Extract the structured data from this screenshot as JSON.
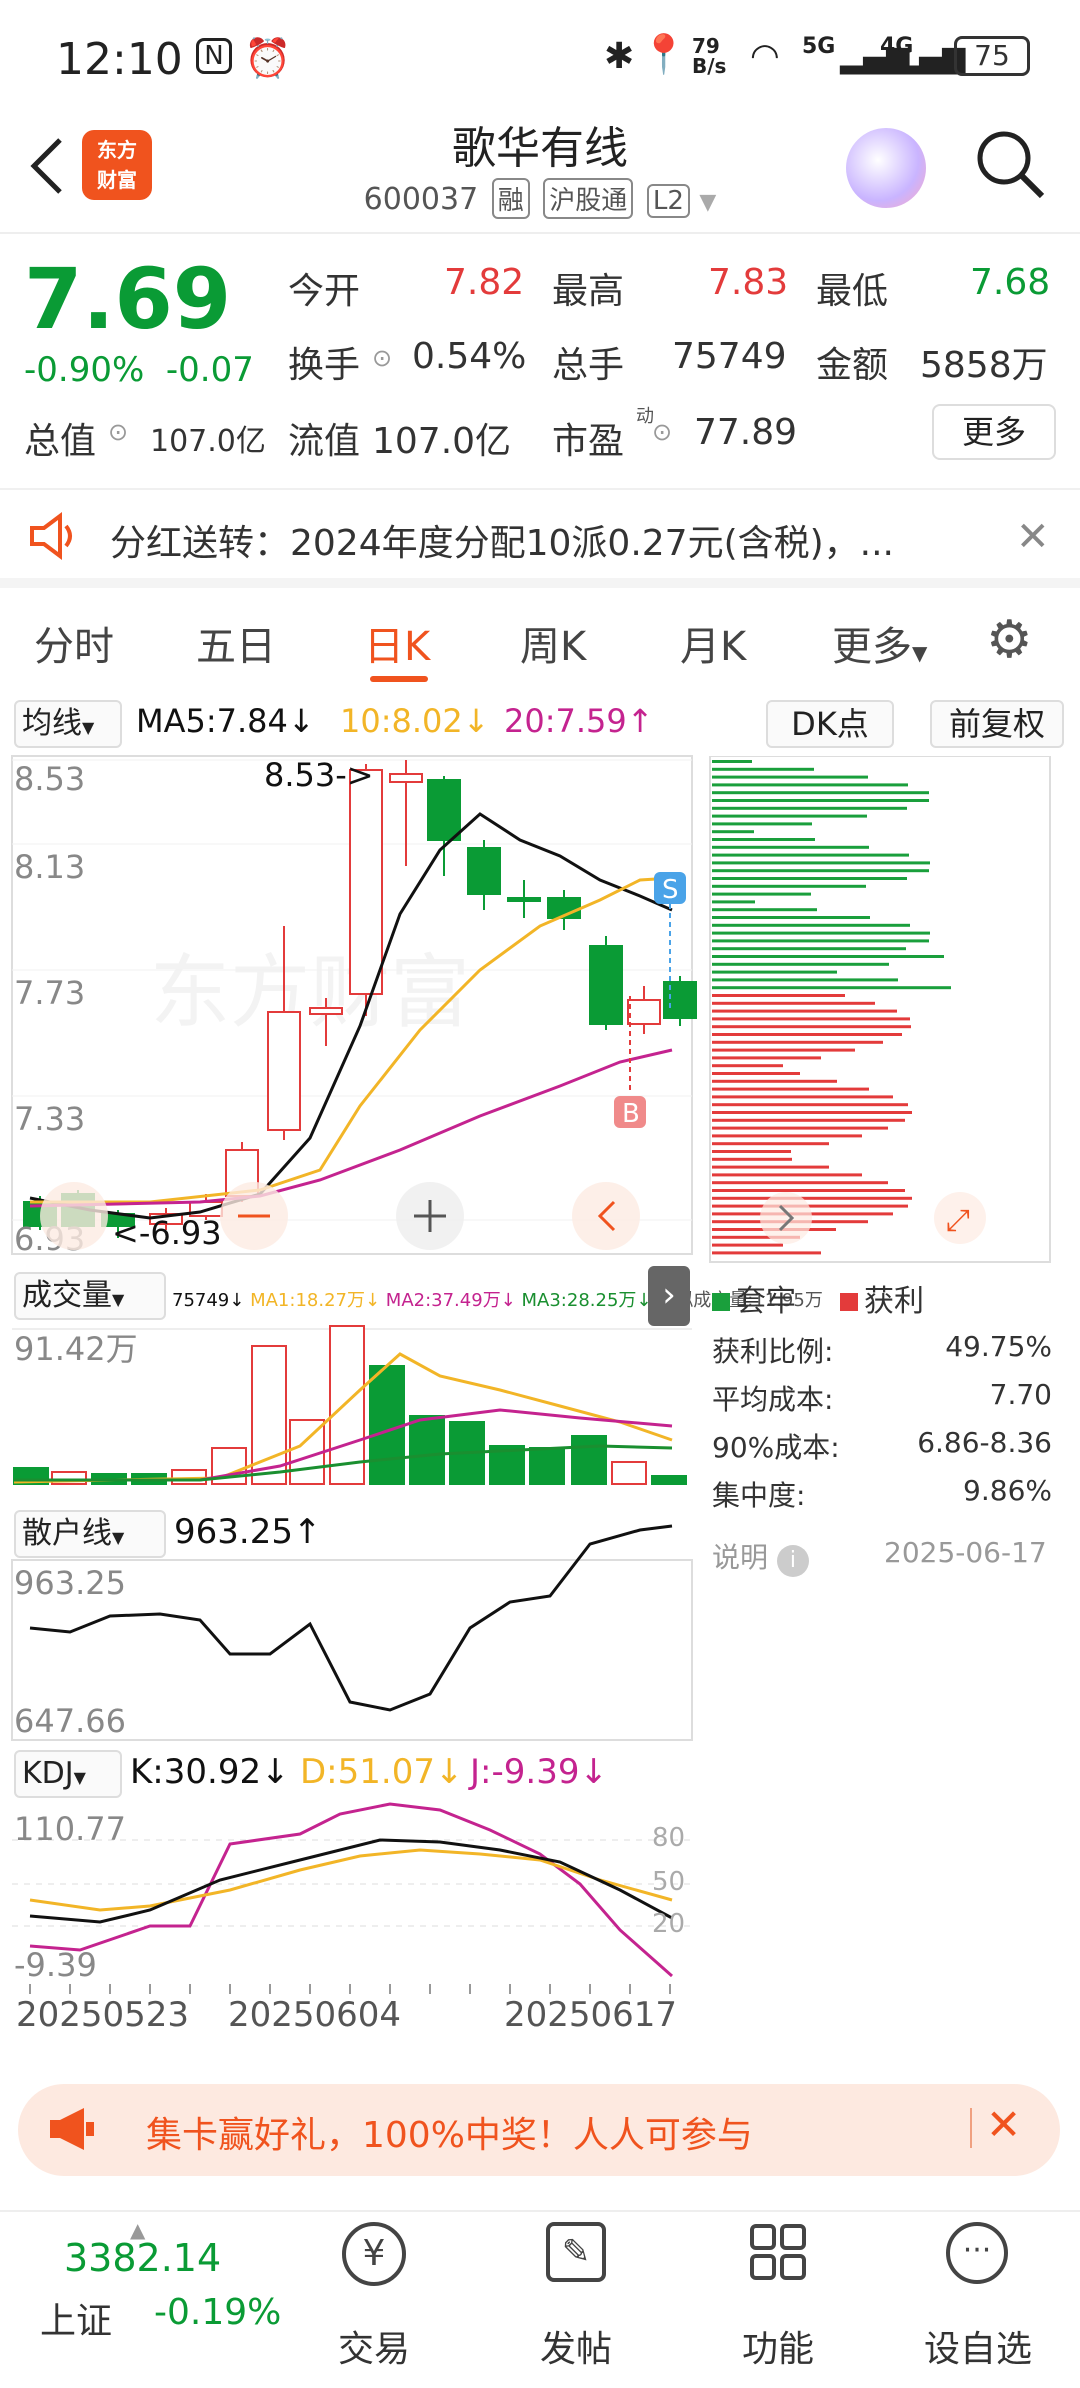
{
  "status": {
    "time": "12:10",
    "net_speed": "79\nB/s",
    "battery": "75",
    "sig1": "5G",
    "sig2": "4G"
  },
  "header": {
    "title": "歌华有线",
    "code": "600037",
    "tags": [
      "融",
      "沪股通",
      "L2"
    ],
    "logo": "东方\n财富",
    "back_icon": "back-icon",
    "search_icon": "search-icon"
  },
  "quote": {
    "price": "7.69",
    "change_pct": "-0.90%",
    "change": "-0.07",
    "open_label": "今开",
    "open": "7.82",
    "high_label": "最高",
    "high": "7.83",
    "low_label": "最低",
    "low": "7.68",
    "turnover_label": "换手",
    "turnover": "0.54%",
    "vol_label": "总手",
    "vol": "75749",
    "amount_label": "金额",
    "amount": "5858万",
    "mcap_label": "总值",
    "mcap": "107.0亿",
    "float_label": "流值",
    "float": "107.0亿",
    "pe_label": "市盈",
    "pe_sup": "动",
    "pe": "77.89",
    "more": "更多"
  },
  "notice": {
    "text": "分红送转：2024年度分配10派0.27元(含税)，..."
  },
  "tabs": [
    "分时",
    "五日",
    "日K",
    "周K",
    "月K",
    "更多"
  ],
  "kline": {
    "ma_label": "均线",
    "ma5": "MA5:7.84↓",
    "ma10": "10:8.02↓",
    "ma20": "20:7.59↑",
    "dk": "DK点",
    "fq": "前复权",
    "ylabels": [
      "8.53",
      "8.13",
      "7.73",
      "7.33",
      "6.93"
    ],
    "hi_note": "8.53->",
    "lo_note": "<-6.93",
    "s": "S",
    "b": "B",
    "watermark": "东方财富"
  },
  "volume": {
    "label": "成交量",
    "info": "75749↓",
    "ma1": "MA1:18.27万↓",
    "ma2": "MA2:37.49万↓",
    "ma3": "MA3:28.25万↓",
    "virt": "虚拟成交量:11.95万",
    "max": "91.42万"
  },
  "retail": {
    "label": "散户线",
    "value": "963.25↑",
    "max": "963.25",
    "min": "647.66"
  },
  "kdj": {
    "label": "KDJ",
    "k": "K:30.92↓",
    "d": "D:51.07↓",
    "j": "J:-9.39↓",
    "max": "110.77",
    "min": "-9.39",
    "levels": [
      "80",
      "50",
      "20"
    ]
  },
  "dates": [
    "20250523",
    "20250604",
    "20250617"
  ],
  "chip": {
    "legend_trap": "套牢",
    "legend_profit": "获利",
    "rows": [
      {
        "k": "获利比例:",
        "v": "49.75%"
      },
      {
        "k": "平均成本:",
        "v": "7.70"
      },
      {
        "k": "90%成本:",
        "v": "6.86-8.36"
      },
      {
        "k": "集中度:",
        "v": "9.86%"
      }
    ],
    "note": "说明",
    "date": "2025-06-17"
  },
  "promo": {
    "text": "集卡赢好礼，100%中奖！人人可参与"
  },
  "nav": {
    "index_val": "3382.14",
    "index_name": "上证",
    "index_chg": "-0.19%",
    "items": [
      "交易",
      "发帖",
      "功能",
      "设自选"
    ]
  },
  "colors": {
    "up": "#e33b3b",
    "down": "#0a9b35",
    "accent": "#f0531e",
    "ma5": "#111111",
    "ma10": "#f2b527",
    "ma20": "#c4238f"
  }
}
